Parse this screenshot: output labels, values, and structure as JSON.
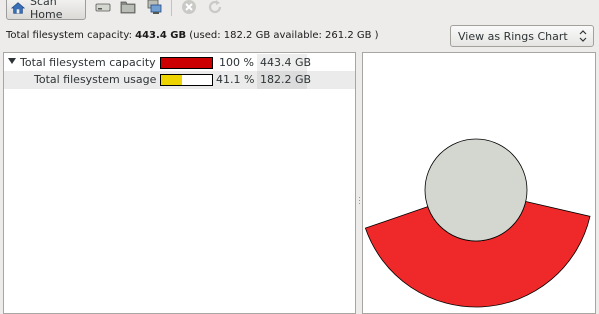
{
  "toolbar": {
    "scan_home_label": "Scan Home"
  },
  "info": {
    "prefix": "Total filesystem capacity: ",
    "capacity": "443.4 GB",
    "details": " (used: 182.2 GB available: 261.2 GB )"
  },
  "view_select": {
    "value": "View as Rings Chart"
  },
  "tree": {
    "rows": [
      {
        "name": "Total filesystem capacity",
        "percent_text": "100 %",
        "size": "443.4 GB",
        "fraction": 1.0,
        "bar_color": "#cc0000"
      },
      {
        "name": "Total filesystem usage",
        "percent_text": "41.1 %",
        "size": "182.2 GB",
        "fraction": 0.411,
        "bar_color": "#edd400"
      }
    ]
  },
  "colors": {
    "ring_fill": "#ef2929",
    "center_fill": "#d3d7cf"
  },
  "icons": [
    "home-icon",
    "disk-icon",
    "folder-icon",
    "remote-folder-icon",
    "stop-icon",
    "refresh-icon",
    "chevron-updown-icon"
  ]
}
